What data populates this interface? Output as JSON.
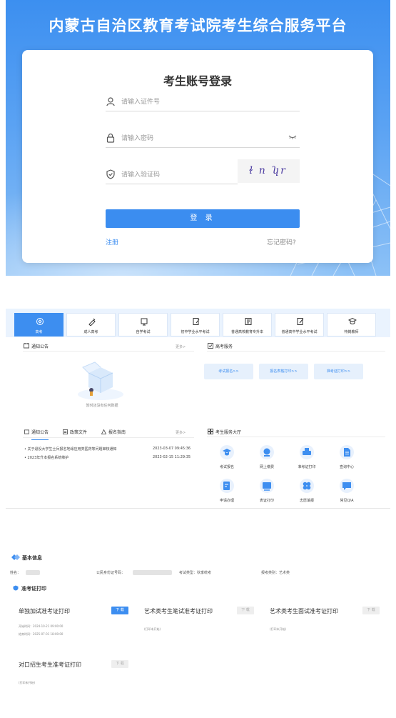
{
  "login": {
    "platform_title": "内蒙古自治区教育考试院考生综合服务平台",
    "card_title": "考生账号登录",
    "id_placeholder": "请输入证件号",
    "password_placeholder": "请输入密码",
    "captcha_placeholder": "请输入验证码",
    "captcha_text": "ɫ n ʮr",
    "login_button": "登 录",
    "register_link": "注册",
    "forgot_link": "忘记密码?"
  },
  "portal": {
    "nav_tabs": [
      {
        "label": "高考",
        "icon": "gaokao-icon",
        "active": true
      },
      {
        "label": "成人高考",
        "icon": "adult-exam-icon",
        "active": false
      },
      {
        "label": "自学考试",
        "icon": "self-study-icon",
        "active": false
      },
      {
        "label": "初中学业水平考试",
        "icon": "junior-exam-icon",
        "active": false
      },
      {
        "label": "普通高校教育专升本",
        "icon": "upgrade-icon",
        "active": false
      },
      {
        "label": "普通高中学业水平考试",
        "icon": "senior-exam-icon",
        "active": false
      },
      {
        "label": "特岗教师",
        "icon": "teacher-icon",
        "active": false
      }
    ],
    "notice_panel_title": "通知公告",
    "notice_more": "更多>",
    "empty_text": "暂时还没有任何数据",
    "service_panel_title": "高考服务",
    "service_buttons": [
      "考试报名>>",
      "报名表格打印>>",
      "准考证打印>>"
    ],
    "lower_tabs": [
      "通知公告",
      "政策文件",
      "报名指南"
    ],
    "lower_more": "更多>",
    "notices": [
      {
        "title": "关于退役大学生士兵报名地缘应用类医药等问题审核通知",
        "date": "2023-03-07 09:45:36"
      },
      {
        "title": "2023年升本报名系统维护",
        "date": "2023-02-15 11:29:35"
      }
    ],
    "hall_title": "考生服务大厅",
    "hall_items": [
      {
        "label": "考试报名",
        "icon": "graduation-cap-icon"
      },
      {
        "label": "网上缴费",
        "icon": "payment-icon"
      },
      {
        "label": "准考证打印",
        "icon": "printer-icon"
      },
      {
        "label": "查询中心",
        "icon": "document-icon"
      },
      {
        "label": "申请办理",
        "icon": "edit-form-icon"
      },
      {
        "label": "表证打印",
        "icon": "certificate-print-icon"
      },
      {
        "label": "志愿填报",
        "icon": "clover-icon"
      },
      {
        "label": "常见Q/A",
        "icon": "qa-icon"
      }
    ],
    "colors": {
      "accent": "#3d8ef0",
      "nav_bg": "#eaf3fe"
    }
  },
  "ticket": {
    "basic_info_title": "基本信息",
    "name_label": "姓名：",
    "id_label": "公民身份证号码：",
    "exam_type_label": "考试类型：秋季统考",
    "category_label": "报考类别：艺术类",
    "print_title": "准考证打印",
    "cards": [
      {
        "title": "单独加试准考证打印",
        "button": "下 载",
        "enabled": true,
        "start": "开始时间：2024-10-21 09:00:00",
        "end": "结束时间：2025-07-01 18:00:00"
      },
      {
        "title": "艺术类考生笔试准考证打印",
        "button": "下 载",
        "enabled": false,
        "note": "(打印未开始)"
      },
      {
        "title": "艺术类考生面试准考证打印",
        "button": "下 载",
        "enabled": false,
        "note": "(打印未开始)"
      },
      {
        "title": "对口招生考生准考证打印",
        "button": "下 载",
        "enabled": false,
        "note": "(打印未开始)"
      }
    ]
  }
}
